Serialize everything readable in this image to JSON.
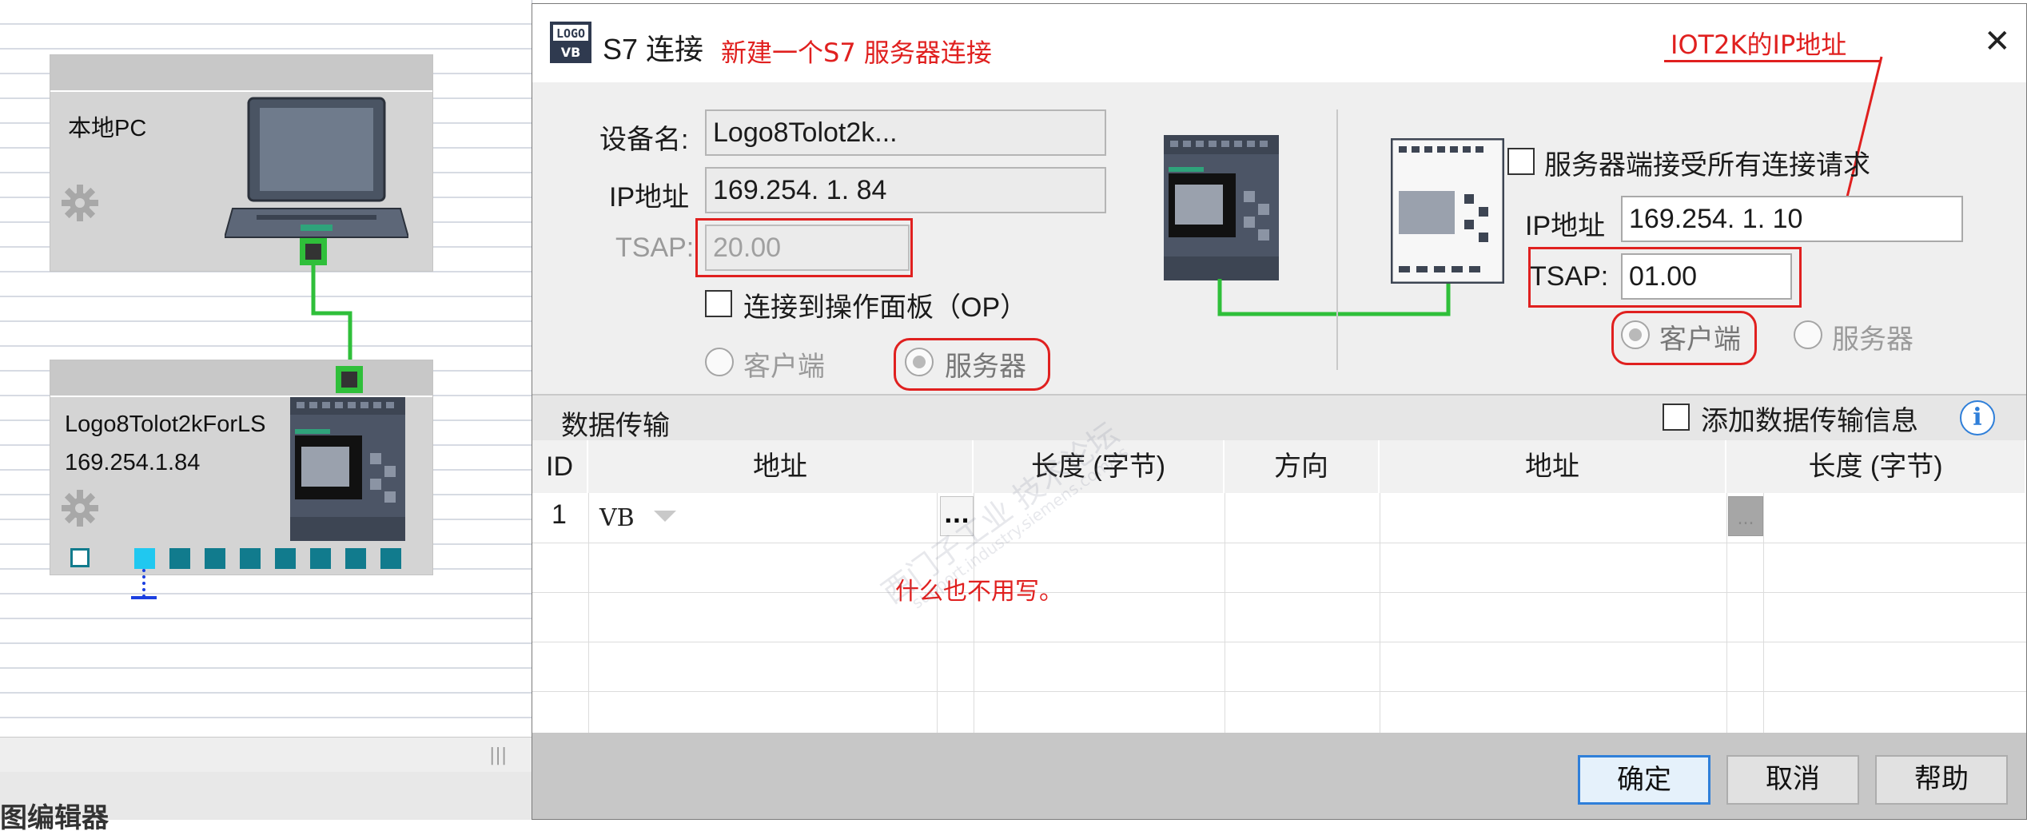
{
  "network_view": {
    "pc_node": {
      "label": "本地PC"
    },
    "logo_node": {
      "name": "Logo8Tolot2kForLS",
      "ip": "169.254.1.84"
    },
    "editor_label": "图编辑器"
  },
  "dialog": {
    "title": "S7 连接",
    "title_annotation": "新建一个S7 服务器连接",
    "close_label": "✕",
    "local": {
      "device_name_label": "设备名:",
      "device_name_value": "Logo8Tolot2k...",
      "ip_label": "IP地址",
      "ip_value": "169.254.  1. 84",
      "tsap_label": "TSAP:",
      "tsap_value": "20.00",
      "op_checkbox_label": "连接到操作面板（OP）",
      "client_label": "客户端",
      "server_label": "服务器",
      "selected_role": "server"
    },
    "remote": {
      "annotation": "IOT2K的IP地址",
      "accept_all_label": "服务器端接受所有连接请求",
      "ip_label": "IP地址",
      "ip_value": "169.254.  1. 10",
      "tsap_label": "TSAP:",
      "tsap_value": "01.00",
      "client_label": "客户端",
      "server_label": "服务器",
      "selected_role": "client"
    },
    "data_transfer": {
      "section_title": "数据传输",
      "add_info_label": "添加数据传输信息",
      "columns": [
        "ID",
        "地址",
        "长度 (字节)",
        "方向",
        "地址",
        "长度 (字节)"
      ],
      "rows": [
        {
          "id": "1",
          "address": "VB"
        }
      ],
      "annotation": "什么也不用写。",
      "dots": "..."
    },
    "buttons": {
      "ok": "确定",
      "cancel": "取消",
      "help": "帮助"
    }
  },
  "watermark": {
    "line1": "西门子工业 技术论坛",
    "line2": "support.industry.siemens.com/cs"
  },
  "colors": {
    "annotation_red": "#e0201f",
    "connection_green": "#2fbf3a",
    "port_teal": "#117b8d",
    "primary_blue": "#2f7fd9"
  }
}
